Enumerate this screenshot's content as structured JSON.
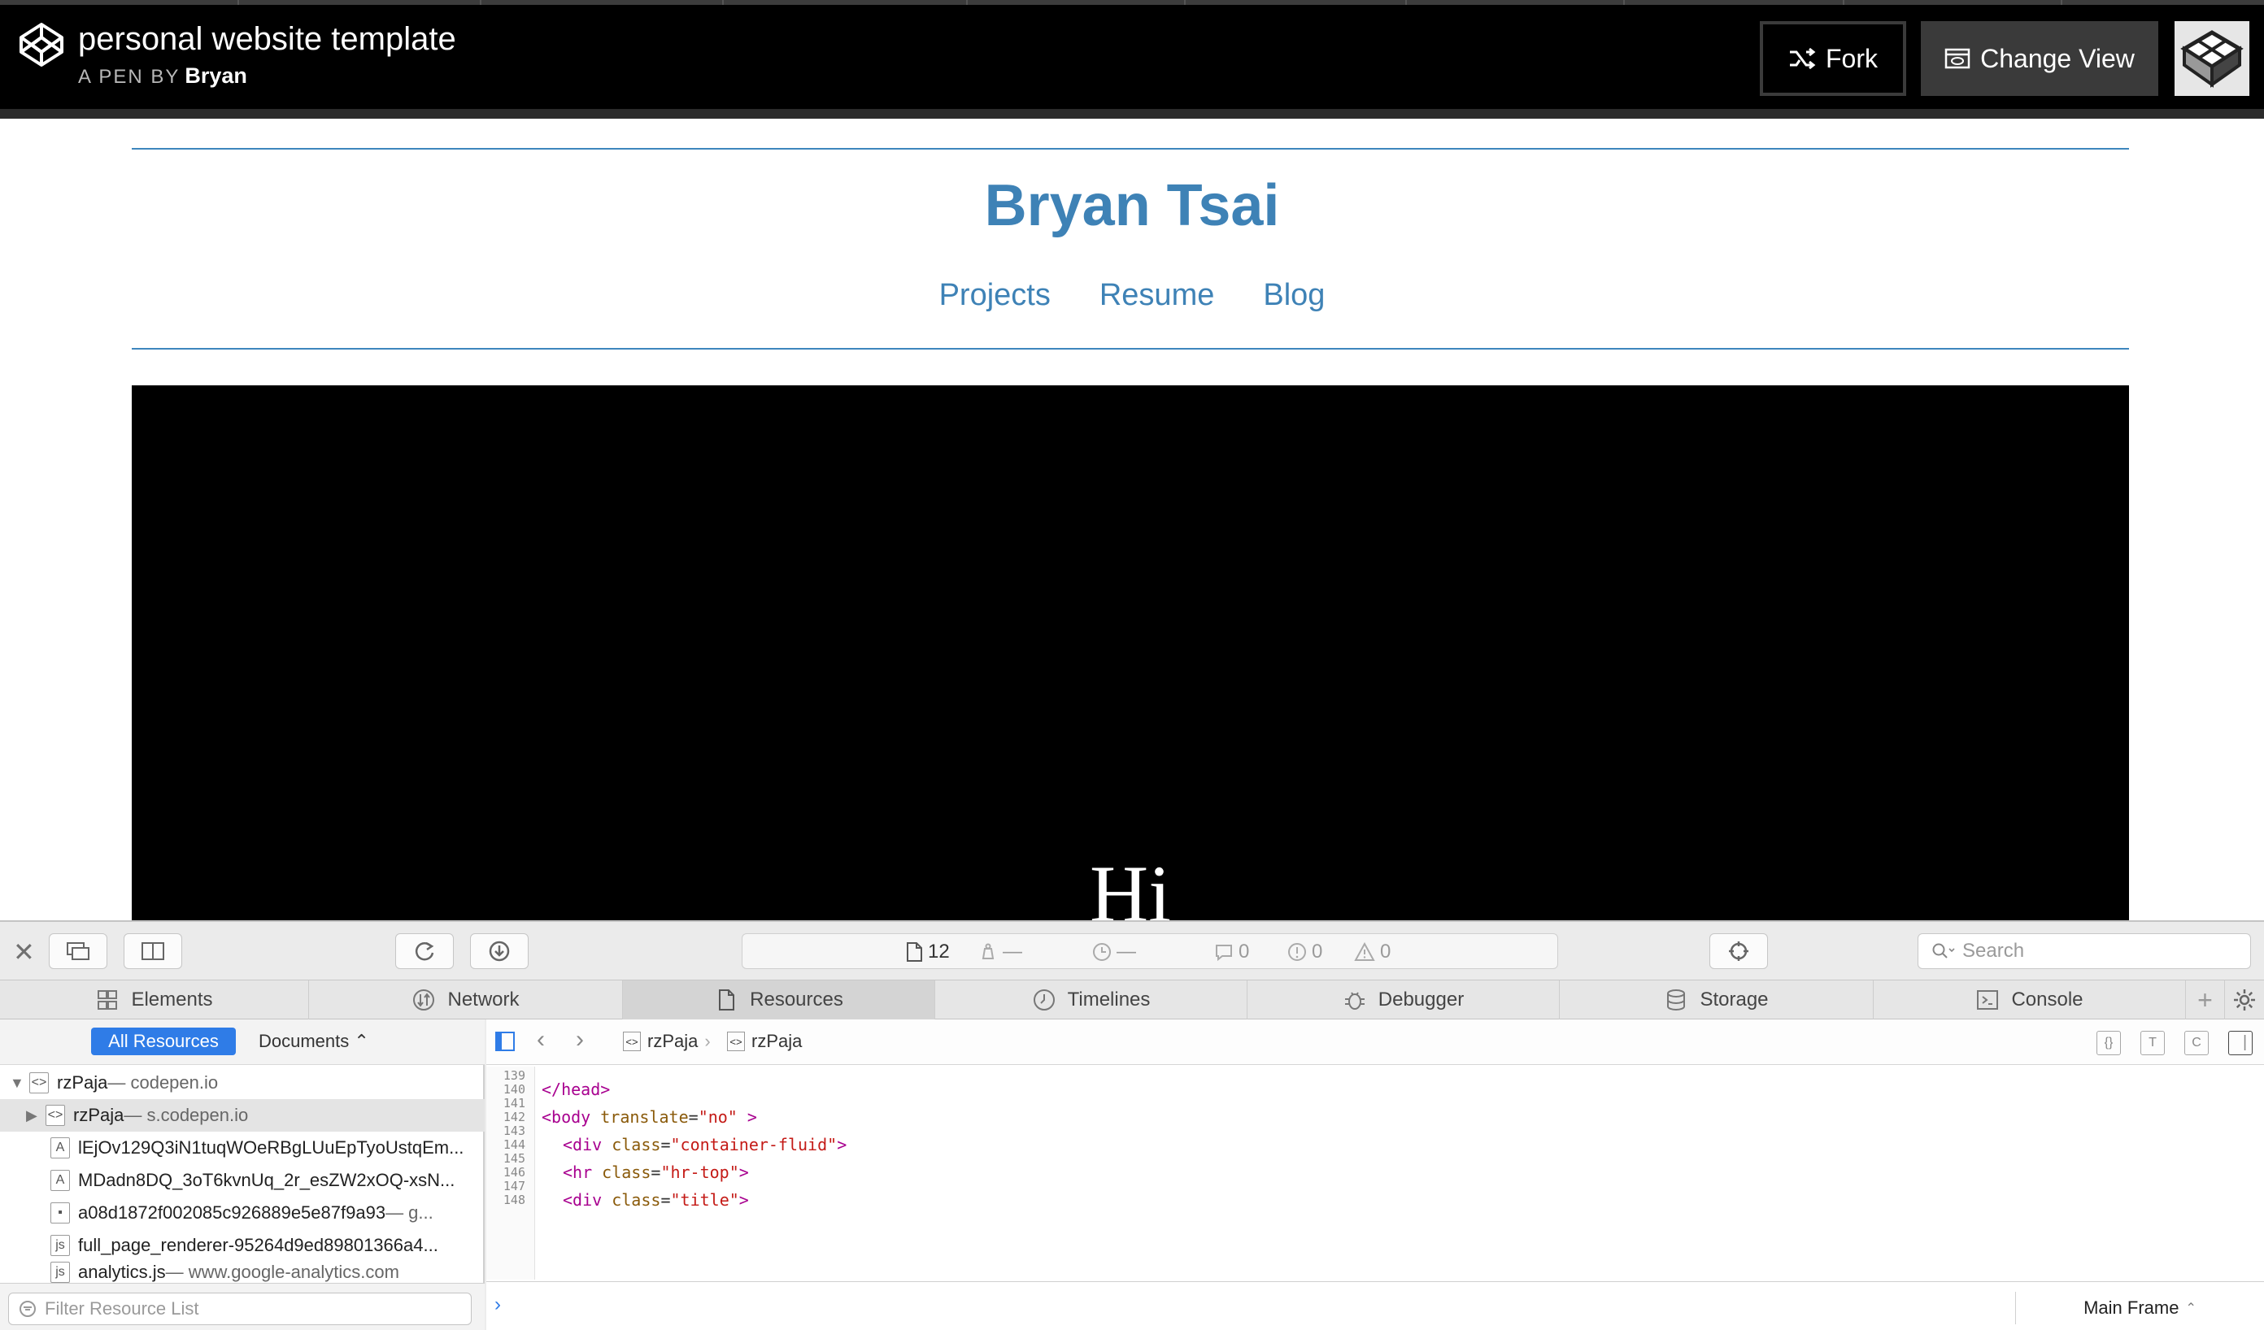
{
  "header": {
    "title": "personal website template",
    "by_label": "A PEN BY",
    "author": "Bryan",
    "fork_label": "Fork",
    "change_view_label": "Change View"
  },
  "preview": {
    "name": "Bryan Tsai",
    "nav": [
      "Projects",
      "Resume",
      "Blog"
    ],
    "hero_text": "Hi"
  },
  "inspector": {
    "toolbar": {
      "resource_count": "12",
      "dash1": "—",
      "dash2": "—",
      "messages": "0",
      "errors": "0",
      "warnings": "0",
      "search_placeholder": "Search"
    },
    "tabs": [
      "Elements",
      "Network",
      "Resources",
      "Timelines",
      "Debugger",
      "Storage",
      "Console"
    ],
    "active_tab": "Resources",
    "sidebar": {
      "all_resources": "All Resources",
      "documents": "Documents",
      "filter_placeholder": "Filter Resource List",
      "items": [
        {
          "name": "rzPaja",
          "host": " — codepen.io"
        },
        {
          "name": "rzPaja",
          "host": " — s.codepen.io"
        },
        {
          "name": "lEjOv129Q3iN1tuqWOeRBgLUuEpTyoUstqEm...",
          "host": ""
        },
        {
          "name": "MDadn8DQ_3oT6kvnUq_2r_esZW2xOQ-xsN...",
          "host": ""
        },
        {
          "name": "a08d1872f002085c926889e5e87f9a93",
          "host": " — g..."
        },
        {
          "name": "full_page_renderer-95264d9ed89801366a4...",
          "host": ""
        },
        {
          "name": "analytics.js",
          "host": " — www.google-analytics.com"
        }
      ]
    },
    "breadcrumb": [
      "rzPaja",
      "rzPaja"
    ],
    "code": {
      "line_numbers": [
        "139",
        "140",
        "141",
        "142",
        "143",
        "144",
        "145",
        "146",
        "147",
        "148"
      ],
      "lines": {
        "l140": "</head>",
        "l142_tag": "<body",
        "l142_attr": "translate",
        "l142_val": "\"no\"",
        "l142_end": ">",
        "l144_tag": "<div",
        "l144_attr": "class",
        "l144_val": "\"container-fluid\"",
        "l144_end": ">",
        "l146_tag": "<hr",
        "l146_attr": "class",
        "l146_val": "\"hr-top\"",
        "l146_end": ">",
        "l148_tag": "<div",
        "l148_attr": "class",
        "l148_val": "\"title\"",
        "l148_end": ">"
      }
    },
    "frame_selector": "Main Frame"
  },
  "colors": {
    "link_blue": "#3e82b6",
    "selected_pill": "#2f7ce7",
    "header_bg": "#000000"
  }
}
